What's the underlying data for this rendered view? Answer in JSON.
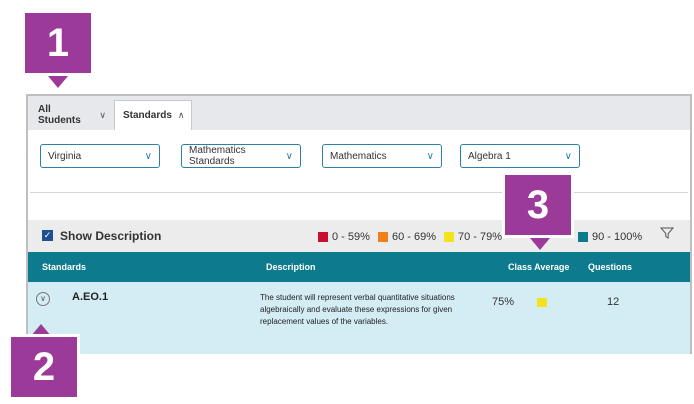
{
  "tabs": [
    {
      "label": "All Students"
    },
    {
      "label": "Standards"
    }
  ],
  "filters": [
    {
      "value": "Virginia"
    },
    {
      "value": "Mathematics Standards"
    },
    {
      "value": "Mathematics"
    },
    {
      "value": "Algebra 1"
    }
  ],
  "description_bar": {
    "checkbox_label": "Show Description",
    "checked": true,
    "legend": [
      {
        "label": "0 - 59%",
        "color": "#c8102e"
      },
      {
        "label": "60 - 69%",
        "color": "#f07f1a"
      },
      {
        "label": "70 - 79%",
        "color": "#f2e31a"
      },
      {
        "label": "90 - 100%",
        "color": "#0e7a8d"
      }
    ]
  },
  "table": {
    "headers": {
      "standards": "Standards",
      "description": "Description",
      "class_average": "Class Average",
      "questions": "Questions"
    },
    "rows": [
      {
        "standard": "A.EO.1",
        "description": "The student will represent verbal quantitative situations algebraically and evaluate these expressions for given replacement values of the variables.",
        "class_average": "75%",
        "average_color": "#f2e31a",
        "questions": "12"
      }
    ]
  },
  "callouts": [
    "1",
    "2",
    "3"
  ],
  "colors": {
    "accent": "#0e7a8d",
    "callout": "#9b3a98",
    "dropdown_border": "#2c7fa8"
  }
}
